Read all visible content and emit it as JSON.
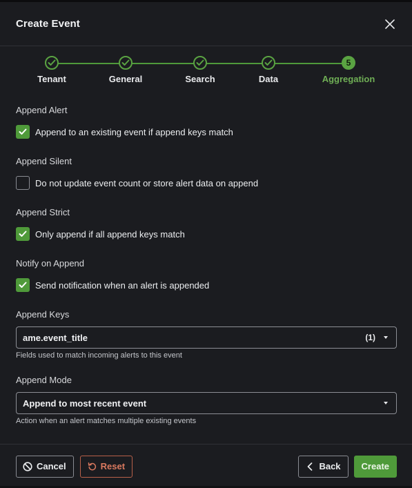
{
  "dialog": {
    "title": "Create Event"
  },
  "stepper": {
    "steps": [
      {
        "label": "Tenant",
        "state": "complete"
      },
      {
        "label": "General",
        "state": "complete"
      },
      {
        "label": "Search",
        "state": "complete"
      },
      {
        "label": "Data",
        "state": "complete"
      },
      {
        "label": "Aggregation",
        "state": "active",
        "number": "5"
      }
    ]
  },
  "form": {
    "append_alert": {
      "label": "Append Alert",
      "checkbox_text": "Append to an existing event if append keys match",
      "checked": true
    },
    "append_silent": {
      "label": "Append Silent",
      "checkbox_text": "Do not update event count or store alert data on append",
      "checked": false
    },
    "append_strict": {
      "label": "Append Strict",
      "checkbox_text": "Only append if all append keys match",
      "checked": true
    },
    "notify_on_append": {
      "label": "Notify on Append",
      "checkbox_text": "Send notification when an alert is appended",
      "checked": true
    },
    "append_keys": {
      "label": "Append Keys",
      "value": "ame.event_title",
      "count": "(1)",
      "help": "Fields used to match incoming alerts to this event"
    },
    "append_mode": {
      "label": "Append Mode",
      "value": "Append to most recent event",
      "help": "Action when an alert matches multiple existing events"
    }
  },
  "footer": {
    "cancel_label": "Cancel",
    "reset_label": "Reset",
    "back_label": "Back",
    "create_label": "Create"
  },
  "colors": {
    "accent": "#4f9a3a",
    "active_step_text": "#6fae55",
    "reset": "#d9795f",
    "background": "#1b1c20"
  },
  "icons": {
    "close": "close-icon",
    "check": "check-icon",
    "cancel": "ban-icon",
    "reset": "undo-icon",
    "back": "chevron-left-icon",
    "dropdown": "caret-down-icon"
  }
}
